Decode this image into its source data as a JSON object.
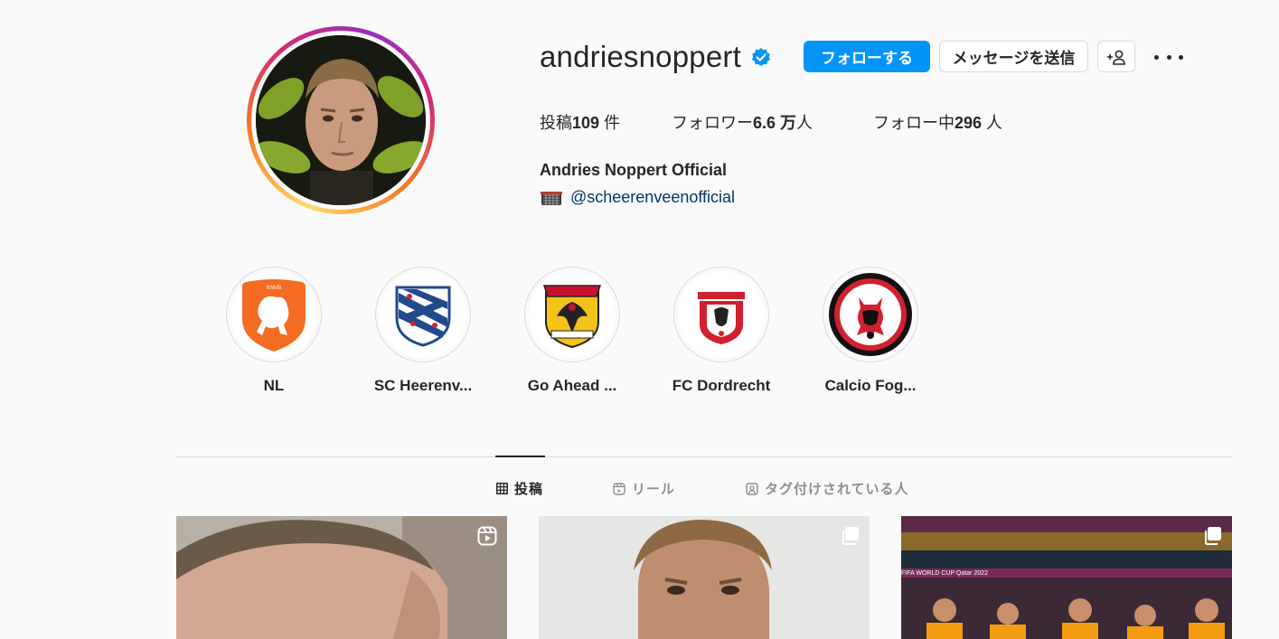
{
  "profile": {
    "username": "andriesnoppert",
    "verified": true,
    "full_name": "Andries Noppert Official",
    "bio_link": "@scheerenveenofficial",
    "bio_icon": "goal-net-emoji"
  },
  "actions": {
    "follow_label": "フォローする",
    "message_label": "メッセージを送信",
    "suggest_icon": "person-plus-icon",
    "more_icon": "more-options-icon"
  },
  "stats": {
    "posts_prefix": "投稿",
    "posts_value": "109",
    "posts_suffix": " 件",
    "followers_prefix": "フォロワー",
    "followers_value": "6.6 万",
    "followers_suffix": "人",
    "following_prefix": "フォロー中",
    "following_value": "296",
    "following_suffix": " 人"
  },
  "highlights": [
    {
      "label": "NL",
      "icon": "knvb-lion-logo"
    },
    {
      "label": "SC Heerenv...",
      "icon": "sc-heerenveen-logo"
    },
    {
      "label": "Go Ahead ...",
      "icon": "go-ahead-eagles-logo"
    },
    {
      "label": "FC Dordrecht",
      "icon": "fc-dordrecht-logo"
    },
    {
      "label": "Calcio Fog...",
      "icon": "calcio-foggia-logo"
    }
  ],
  "tabs": [
    {
      "label": "投稿",
      "icon": "grid-icon",
      "active": true
    },
    {
      "label": "リール",
      "icon": "reels-icon",
      "active": false
    },
    {
      "label": "タグ付けされている人",
      "icon": "tagged-icon",
      "active": false
    }
  ],
  "posts": [
    {
      "type": "reel",
      "icon": "reel-icon"
    },
    {
      "type": "carousel",
      "icon": "carousel-icon"
    },
    {
      "type": "carousel",
      "icon": "carousel-icon",
      "banner_text": "FIFA WORLD CUP Qatar 2022"
    }
  ],
  "colors": {
    "accent": "#0095f6",
    "link": "#00376b",
    "verified": "#0095f6",
    "text": "#262626",
    "muted": "#8e8e8e"
  }
}
